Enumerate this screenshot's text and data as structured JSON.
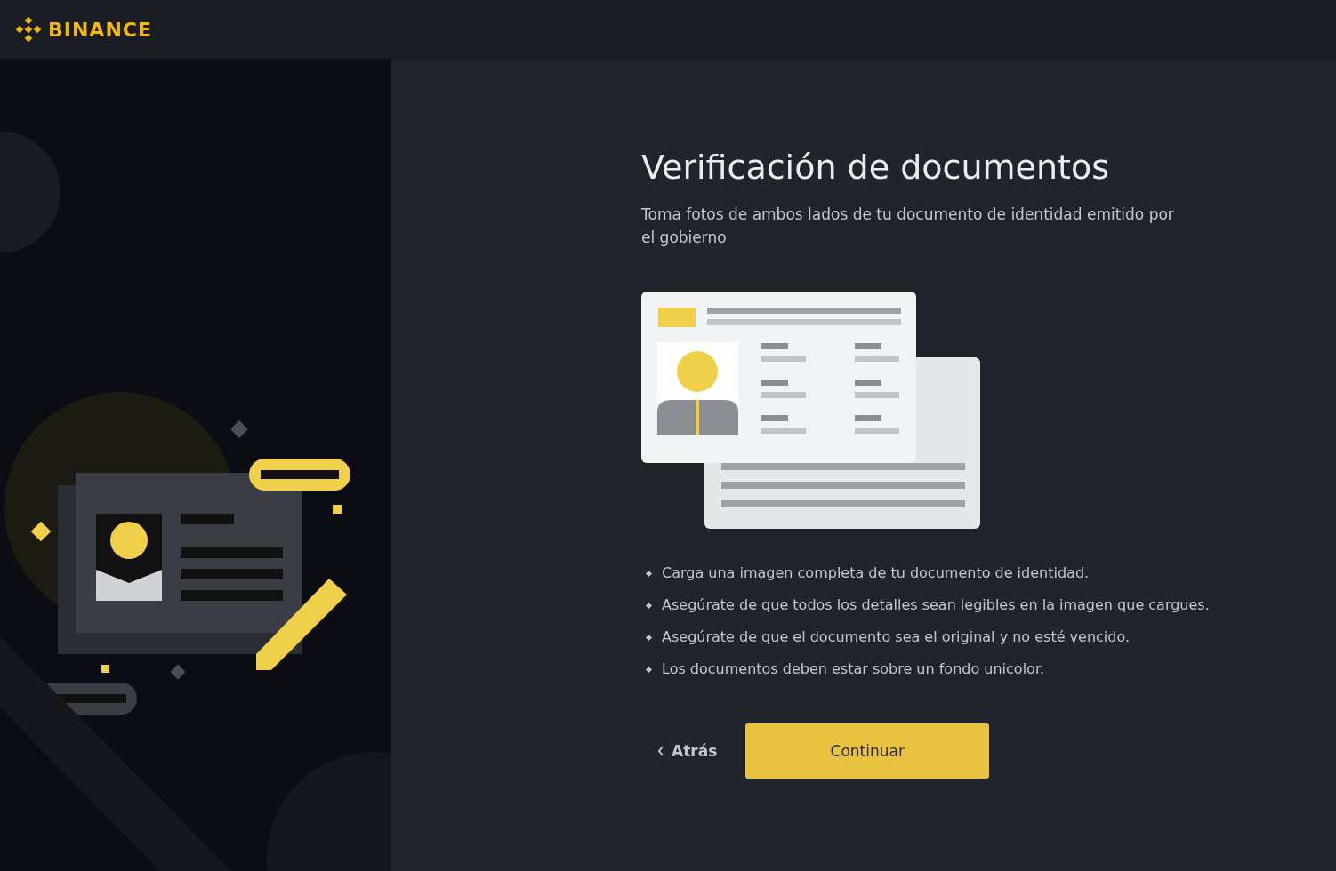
{
  "header": {
    "brand": "BINANCE"
  },
  "main": {
    "title": "Verificación de documentos",
    "subtitle": "Toma fotos de ambos lados de tu documento de identidad emitido por el gobierno",
    "requirements": [
      "Carga una imagen completa de tu documento de identidad.",
      "Asegúrate de que todos los detalles sean legibles en la imagen que cargues.",
      "Asegúrate de que el documento sea el original y no esté vencido.",
      "Los documentos deben estar sobre un fondo unicolor."
    ],
    "back_button": "Atrás",
    "continue_button": "Continuar"
  }
}
